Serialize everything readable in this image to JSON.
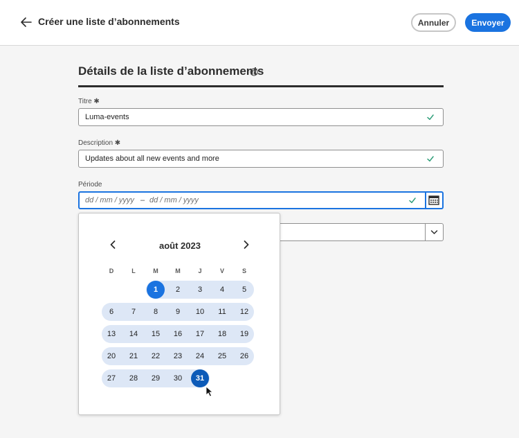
{
  "header": {
    "title": "Créer une liste d’abonnements",
    "cancel_label": "Annuler",
    "send_label": "Envoyer"
  },
  "section": {
    "title": "Détails de la liste d’abonnements"
  },
  "fields": {
    "title_label": "Titre ✱",
    "title_value": "Luma-events",
    "description_label": "Description ✱",
    "description_value": "Updates about all new events and more",
    "period_label": "Période",
    "start_placeholder": "dd / mm / yyyy",
    "separator": "–",
    "end_placeholder": "dd / mm / yyyy"
  },
  "calendar": {
    "month_label": "août 2023",
    "weekdays": [
      "D",
      "L",
      "M",
      "M",
      "J",
      "V",
      "S"
    ],
    "selected_start": "1",
    "selected_end": "31",
    "weeks": [
      [
        "",
        "",
        "1",
        "2",
        "3",
        "4",
        "5"
      ],
      [
        "6",
        "7",
        "8",
        "9",
        "10",
        "11",
        "12"
      ],
      [
        "13",
        "14",
        "15",
        "16",
        "17",
        "18",
        "19"
      ],
      [
        "20",
        "21",
        "22",
        "23",
        "24",
        "25",
        "26"
      ],
      [
        "27",
        "28",
        "29",
        "30",
        "31",
        "",
        ""
      ]
    ]
  },
  "colors": {
    "accent": "#1a73e0",
    "range_fill": "#dde7f6",
    "valid_check": "#2d9d78"
  }
}
